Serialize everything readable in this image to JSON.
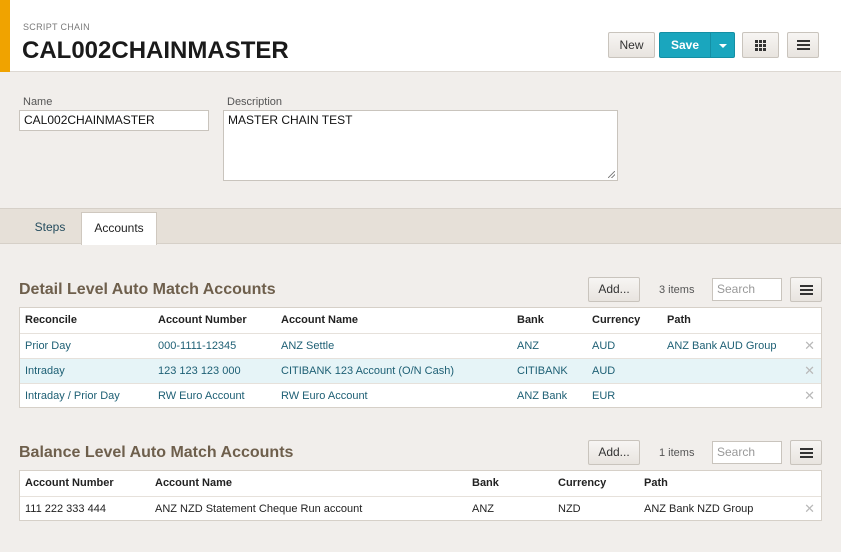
{
  "header": {
    "crumb": "SCRIPT CHAIN",
    "title": "CAL002CHAINMASTER",
    "new_label": "New",
    "save_label": "Save"
  },
  "form": {
    "name_label": "Name",
    "name_value": "CAL002CHAINMASTER",
    "description_label": "Description",
    "description_value": "MASTER CHAIN TEST"
  },
  "tabs": [
    {
      "label": "Steps"
    },
    {
      "label": "Accounts",
      "active": true
    }
  ],
  "detail": {
    "title": "Detail Level Auto Match Accounts",
    "add_label": "Add...",
    "count": "3 items",
    "search_placeholder": "Search",
    "columns": [
      "Reconcile",
      "Account Number",
      "Account Name",
      "Bank",
      "Currency",
      "Path"
    ],
    "rows": [
      {
        "reconcile": "Prior Day",
        "account_number": "000-1111-12345",
        "account_name": "ANZ Settle",
        "bank": "ANZ",
        "currency": "AUD",
        "path": "ANZ Bank AUD Group"
      },
      {
        "reconcile": "Intraday",
        "account_number": "123 123 123 000",
        "account_name": "CITIBANK 123 Account (O/N Cash)",
        "bank": "CITIBANK",
        "currency": "AUD",
        "path": ""
      },
      {
        "reconcile": "Intraday / Prior Day",
        "account_number": "RW Euro Account",
        "account_name": "RW Euro Account",
        "bank": "ANZ Bank",
        "currency": "EUR",
        "path": ""
      }
    ]
  },
  "balance": {
    "title": "Balance Level Auto Match Accounts",
    "add_label": "Add...",
    "count": "1 items",
    "search_placeholder": "Search",
    "columns": [
      "Account Number",
      "Account Name",
      "Bank",
      "Currency",
      "Path"
    ],
    "rows": [
      {
        "account_number": "111 222 333 444",
        "account_name": "ANZ NZD Statement Cheque Run account",
        "bank": "ANZ",
        "currency": "NZD",
        "path": "ANZ Bank NZD Group"
      }
    ]
  },
  "icons": {
    "grid": "grid-icon",
    "menu": "menu-icon",
    "remove": "remove-icon",
    "dropdown": "caret-down-icon"
  },
  "colors": {
    "accent": "#f0a300",
    "primary": "#1aa6be",
    "section_title": "#6e5f4c",
    "link": "#1d5f74",
    "highlight_row": "#e6f4f7"
  }
}
